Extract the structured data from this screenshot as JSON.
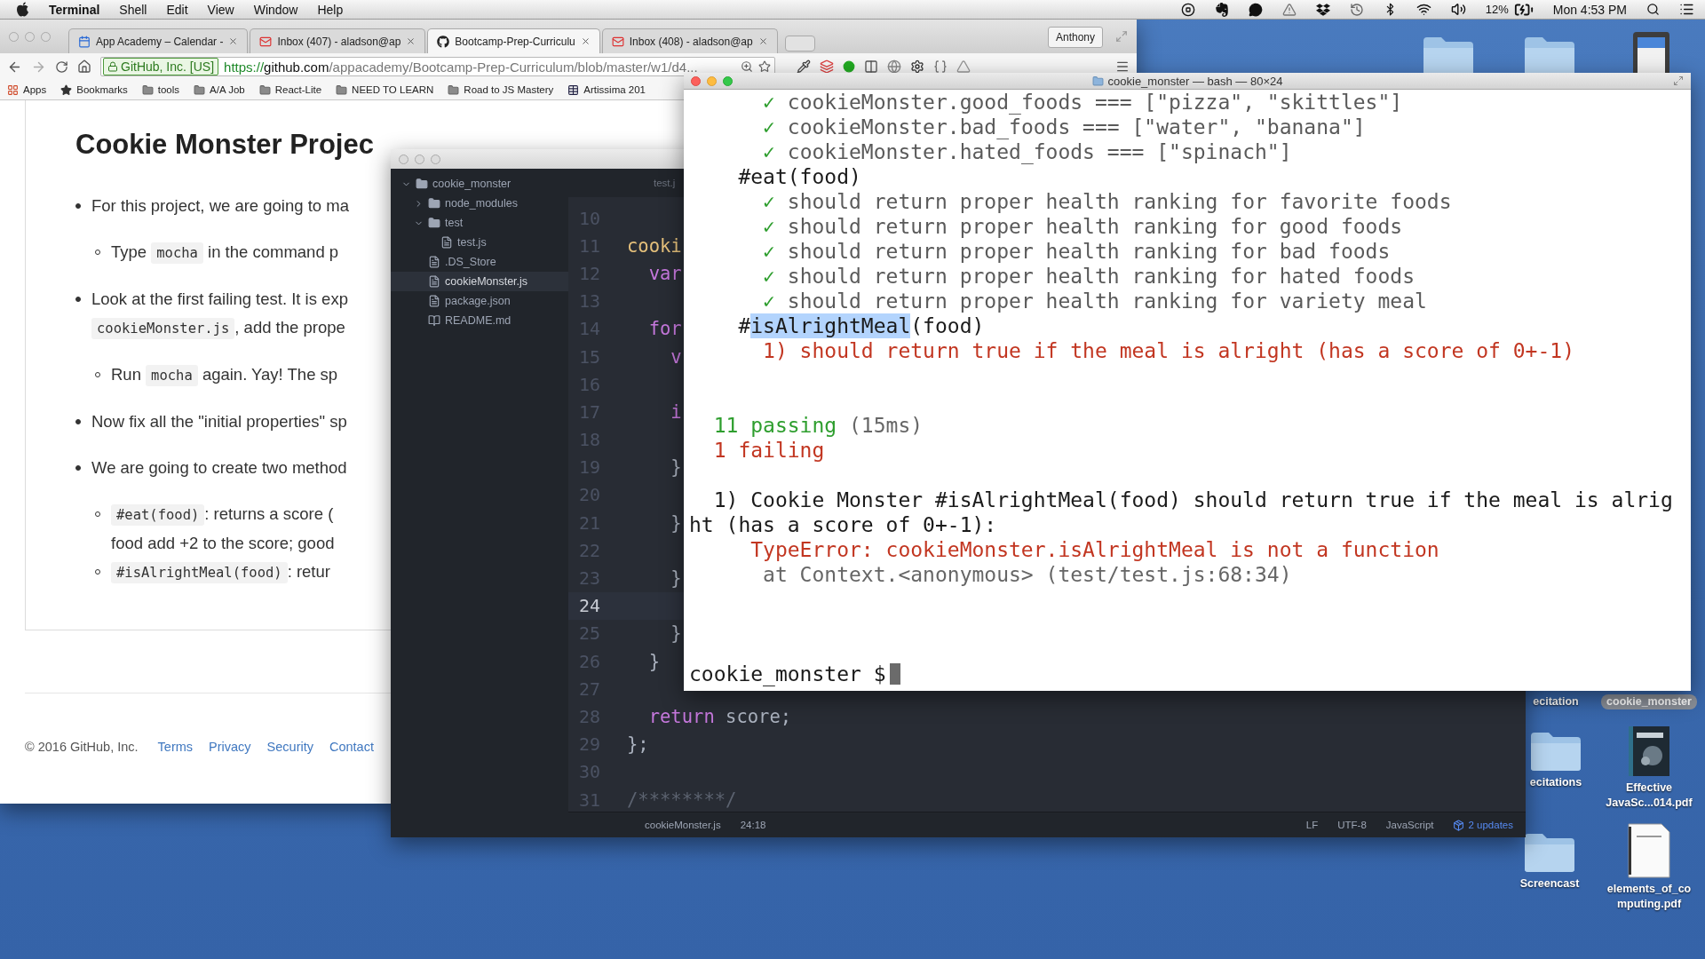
{
  "menu_bar": {
    "app": "Terminal",
    "menus": [
      "Shell",
      "Edit",
      "View",
      "Window",
      "Help"
    ],
    "battery": "12%",
    "clock": "Mon 4:53 PM"
  },
  "browser": {
    "tabs": [
      {
        "kind": "calendar",
        "title": "App Academy – Calendar -",
        "selected": false
      },
      {
        "kind": "mail",
        "title": "Inbox (407) - aladson@ap",
        "selected": false
      },
      {
        "kind": "github",
        "title": "Bootcamp-Prep-Curriculu",
        "selected": true
      },
      {
        "kind": "mail",
        "title": "Inbox (408) - aladson@ap",
        "selected": false
      }
    ],
    "profile": "Anthony",
    "address": {
      "identity": "GitHub, Inc. [US]",
      "scheme": "https://",
      "host": "github.com",
      "path": "/appacademy/Bootcamp-Prep-Curriculum/blob/master/w1/d4..."
    },
    "bookmarks": [
      {
        "kind": "apps",
        "label": "Apps"
      },
      {
        "kind": "star",
        "label": "Bookmarks"
      },
      {
        "kind": "folder",
        "label": "tools"
      },
      {
        "kind": "folder",
        "label": "A/A Job"
      },
      {
        "kind": "folder",
        "label": "React-Lite"
      },
      {
        "kind": "folder",
        "label": "NEED TO LEARN"
      },
      {
        "kind": "folder",
        "label": "Road to JS Mastery"
      },
      {
        "kind": "page",
        "label": "Artissima 201"
      }
    ],
    "page": {
      "title": "Cookie Monster Projec",
      "items": [
        {
          "lines": [
            [
              {
                "kind": "text",
                "text": "For this project, we are going to ma"
              }
            ]
          ],
          "children": [
            {
              "lines": [
                [
                  {
                    "kind": "text",
                    "text": "Type "
                  },
                  {
                    "kind": "code",
                    "text": "mocha"
                  },
                  {
                    "kind": "text",
                    "text": " in the command p"
                  }
                ]
              ]
            }
          ]
        },
        {
          "lines": [
            [
              {
                "kind": "text",
                "text": "Look at the first failing test. It is exp"
              }
            ],
            [
              {
                "kind": "code",
                "text": "cookieMonster.js"
              },
              {
                "kind": "text",
                "text": ", add the prope"
              }
            ]
          ],
          "children": [
            {
              "lines": [
                [
                  {
                    "kind": "text",
                    "text": "Run "
                  },
                  {
                    "kind": "code",
                    "text": "mocha"
                  },
                  {
                    "kind": "text",
                    "text": " again. Yay! The sp"
                  }
                ]
              ]
            }
          ]
        },
        {
          "lines": [
            [
              {
                "kind": "text",
                "text": "Now fix all the \"initial properties\" sp"
              }
            ]
          ]
        },
        {
          "lines": [
            [
              {
                "kind": "text",
                "text": "We are going to create two method"
              }
            ]
          ],
          "children": [
            {
              "lines": [
                [
                  {
                    "kind": "code",
                    "text": "#eat(food)"
                  },
                  {
                    "kind": "text",
                    "text": ": returns a score ("
                  }
                ],
                [
                  {
                    "kind": "text",
                    "text": "food add +2 to the score; good"
                  }
                ]
              ]
            },
            {
              "lines": [
                [
                  {
                    "kind": "code",
                    "text": "#isAlrightMeal(food)"
                  },
                  {
                    "kind": "text",
                    "text": ": retur"
                  }
                ]
              ]
            }
          ]
        }
      ]
    },
    "footer": {
      "copyright": "© 2016 GitHub, Inc.",
      "links": [
        "Terms",
        "Privacy",
        "Security",
        "Contact"
      ]
    }
  },
  "editor": {
    "tab": "test.j",
    "tree": [
      {
        "kind": "folder",
        "name": "cookie_monster",
        "expanded": true,
        "selected": false,
        "children": [
          {
            "kind": "folder",
            "name": "node_modules",
            "expanded": false,
            "selected": false
          },
          {
            "kind": "folder",
            "name": "test",
            "expanded": true,
            "selected": false,
            "children": [
              {
                "kind": "file",
                "name": "test.js",
                "selected": false
              }
            ]
          },
          {
            "kind": "file",
            "name": ".DS_Store",
            "selected": false
          },
          {
            "kind": "file",
            "name": "cookieMonster.js",
            "selected": true
          },
          {
            "kind": "file",
            "name": "package.json",
            "selected": false
          },
          {
            "kind": "readme",
            "name": "README.md",
            "selected": false
          }
        ]
      }
    ],
    "lines": [
      {
        "number": "10",
        "current": false
      },
      {
        "number": "11",
        "current": false,
        "parts": [
          {
            "kind": "function",
            "text": "cooki"
          }
        ]
      },
      {
        "number": "12",
        "current": false,
        "parts": [
          {
            "kind": "keyword",
            "text": "  var"
          }
        ]
      },
      {
        "number": "13",
        "current": false
      },
      {
        "number": "14",
        "current": false,
        "parts": [
          {
            "kind": "keyword",
            "text": "  for"
          }
        ]
      },
      {
        "number": "15",
        "current": false,
        "parts": [
          {
            "kind": "keyword",
            "text": "    v"
          }
        ]
      },
      {
        "number": "16",
        "current": false
      },
      {
        "number": "17",
        "current": false,
        "parts": [
          {
            "kind": "keyword",
            "text": "    i"
          }
        ]
      },
      {
        "number": "18",
        "current": false
      },
      {
        "number": "19",
        "current": false,
        "parts": [
          {
            "kind": "punct",
            "text": "    }"
          }
        ]
      },
      {
        "number": "20",
        "current": false
      },
      {
        "number": "21",
        "current": false,
        "parts": [
          {
            "kind": "punct",
            "text": "    }"
          }
        ]
      },
      {
        "number": "22",
        "current": false
      },
      {
        "number": "23",
        "current": false,
        "parts": [
          {
            "kind": "punct",
            "text": "    }"
          }
        ]
      },
      {
        "number": "24",
        "current": true
      },
      {
        "number": "25",
        "current": false,
        "parts": [
          {
            "kind": "punct",
            "text": "    }"
          }
        ]
      },
      {
        "number": "26",
        "current": false,
        "parts": [
          {
            "kind": "punct",
            "text": "  }"
          }
        ]
      },
      {
        "number": "27",
        "current": false
      },
      {
        "number": "28",
        "current": false,
        "parts": [
          {
            "kind": "keyword",
            "text": "  return"
          },
          {
            "kind": "punct",
            "text": " score;"
          }
        ]
      },
      {
        "number": "29",
        "current": false,
        "parts": [
          {
            "kind": "punct",
            "text": "};"
          }
        ]
      },
      {
        "number": "30",
        "current": false
      },
      {
        "number": "31",
        "current": false,
        "parts": [
          {
            "kind": "comment",
            "text": "/********/"
          }
        ]
      }
    ],
    "status": {
      "file": "cookieMonster.js",
      "position": "24:18",
      "line_ending": "LF",
      "encoding": "UTF-8",
      "grammar": "JavaScript",
      "updates": "2 updates"
    }
  },
  "terminal": {
    "title": "cookie_monster — bash — 80×24",
    "lines": [
      {
        "kind": "text",
        "parts": [
          {
            "kind": "check",
            "text": "      ✓"
          },
          {
            "kind": "test",
            "text": " cookieMonster.good_foods === [\"pizza\", \"skittles\"]"
          }
        ]
      },
      {
        "kind": "text",
        "parts": [
          {
            "kind": "check",
            "text": "      ✓"
          },
          {
            "kind": "test",
            "text": " cookieMonster.bad_foods === [\"water\", \"banana\"]"
          }
        ]
      },
      {
        "kind": "text",
        "parts": [
          {
            "kind": "check",
            "text": "      ✓"
          },
          {
            "kind": "test",
            "text": " cookieMonster.hated_foods === [\"spinach\"]"
          }
        ]
      },
      {
        "kind": "text",
        "parts": [
          {
            "kind": "plain",
            "text": "    #eat(food)"
          }
        ]
      },
      {
        "kind": "text",
        "parts": [
          {
            "kind": "check",
            "text": "      ✓"
          },
          {
            "kind": "test",
            "text": " should return proper health ranking for favorite foods"
          }
        ]
      },
      {
        "kind": "text",
        "parts": [
          {
            "kind": "check",
            "text": "      ✓"
          },
          {
            "kind": "test",
            "text": " should return proper health ranking for good foods"
          }
        ]
      },
      {
        "kind": "text",
        "parts": [
          {
            "kind": "check",
            "text": "      ✓"
          },
          {
            "kind": "test",
            "text": " should return proper health ranking for bad foods"
          }
        ]
      },
      {
        "kind": "text",
        "parts": [
          {
            "kind": "check",
            "text": "      ✓"
          },
          {
            "kind": "test",
            "text": " should return proper health ranking for hated foods"
          }
        ]
      },
      {
        "kind": "text",
        "parts": [
          {
            "kind": "check",
            "text": "      ✓"
          },
          {
            "kind": "test",
            "text": " should return proper health ranking for variety meal"
          }
        ]
      },
      {
        "kind": "text",
        "parts": [
          {
            "kind": "plain",
            "text": "    #"
          },
          {
            "kind": "selection",
            "text": "isAlrightMeal"
          },
          {
            "kind": "plain",
            "text": "(food)"
          }
        ]
      },
      {
        "kind": "text",
        "parts": [
          {
            "kind": "fail",
            "text": "      1) should return true if the meal is alright (has a score of 0+-1)"
          }
        ]
      },
      {
        "kind": "blank"
      },
      {
        "kind": "blank"
      },
      {
        "kind": "text",
        "parts": [
          {
            "kind": "pass",
            "text": "  11 passing"
          },
          {
            "kind": "dim",
            "text": " (15ms)"
          }
        ]
      },
      {
        "kind": "text",
        "parts": [
          {
            "kind": "fail",
            "text": "  1 failing"
          }
        ]
      },
      {
        "kind": "blank"
      },
      {
        "kind": "text",
        "parts": [
          {
            "kind": "plain",
            "text": "  1) Cookie Monster #isAlrightMeal(food) should return true if the meal is alrig"
          }
        ]
      },
      {
        "kind": "text",
        "parts": [
          {
            "kind": "plain",
            "text": "ht (has a score of 0+-1):"
          }
        ]
      },
      {
        "kind": "text",
        "parts": [
          {
            "kind": "fail",
            "text": "     TypeError: cookieMonster.isAlrightMeal is not a function"
          }
        ]
      },
      {
        "kind": "text",
        "parts": [
          {
            "kind": "dim",
            "text": "      at Context.<anonymous> (test/test.js:68:34)"
          }
        ]
      },
      {
        "kind": "blank"
      },
      {
        "kind": "blank"
      },
      {
        "kind": "blank"
      },
      {
        "kind": "prompt",
        "text": "cookie_monster $"
      }
    ]
  },
  "desktop": [
    {
      "kind": "folder"
    },
    {
      "kind": "folder"
    },
    {
      "kind": "card"
    },
    {
      "kind": "label",
      "label": [
        "ecitation"
      ]
    },
    {
      "kind": "tag",
      "label": [
        "cookie_monster"
      ]
    },
    {
      "kind": "folder",
      "label": [
        "ecitations"
      ]
    },
    {
      "kind": "book",
      "label": [
        "Effective",
        "JavaSc...014.pdf"
      ]
    },
    {
      "kind": "folder",
      "label": [
        "Screencast"
      ]
    },
    {
      "kind": "doc",
      "label": [
        "elements_of_co",
        "mputing.pdf"
      ]
    }
  ]
}
